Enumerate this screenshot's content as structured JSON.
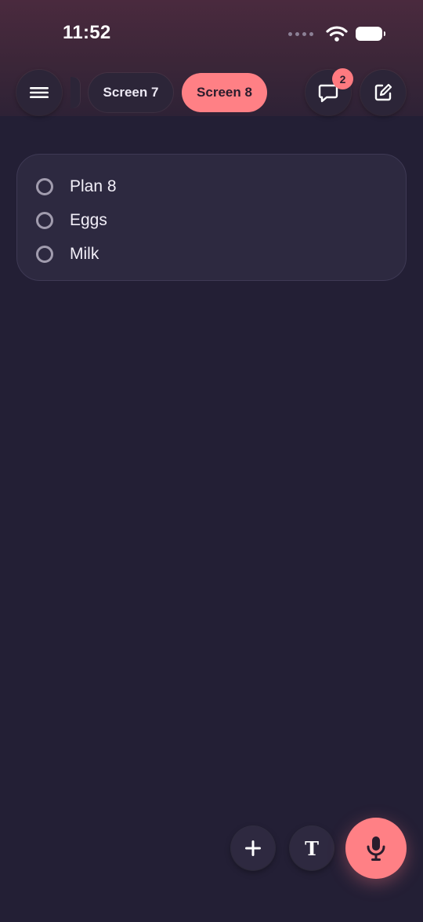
{
  "status_bar": {
    "time": "11:52"
  },
  "toolbar": {
    "menu_icon": "hamburger-icon",
    "tabs": [
      {
        "label": "Screen 7",
        "active": false
      },
      {
        "label": "Screen 8",
        "active": true
      }
    ],
    "comments_icon": "comment-bubble-icon",
    "comments_badge": "2",
    "edit_icon": "edit-note-icon"
  },
  "list": {
    "items": [
      {
        "label": "Plan 8",
        "checked": false
      },
      {
        "label": "Eggs",
        "checked": false
      },
      {
        "label": "Milk",
        "checked": false
      }
    ]
  },
  "actions": {
    "add_icon": "plus-icon",
    "text_label": "T",
    "mic_icon": "microphone-icon"
  },
  "colors": {
    "background": "#231f35",
    "accent": "#ff8085",
    "surface": "#2c2538",
    "card": "#2d2940"
  }
}
